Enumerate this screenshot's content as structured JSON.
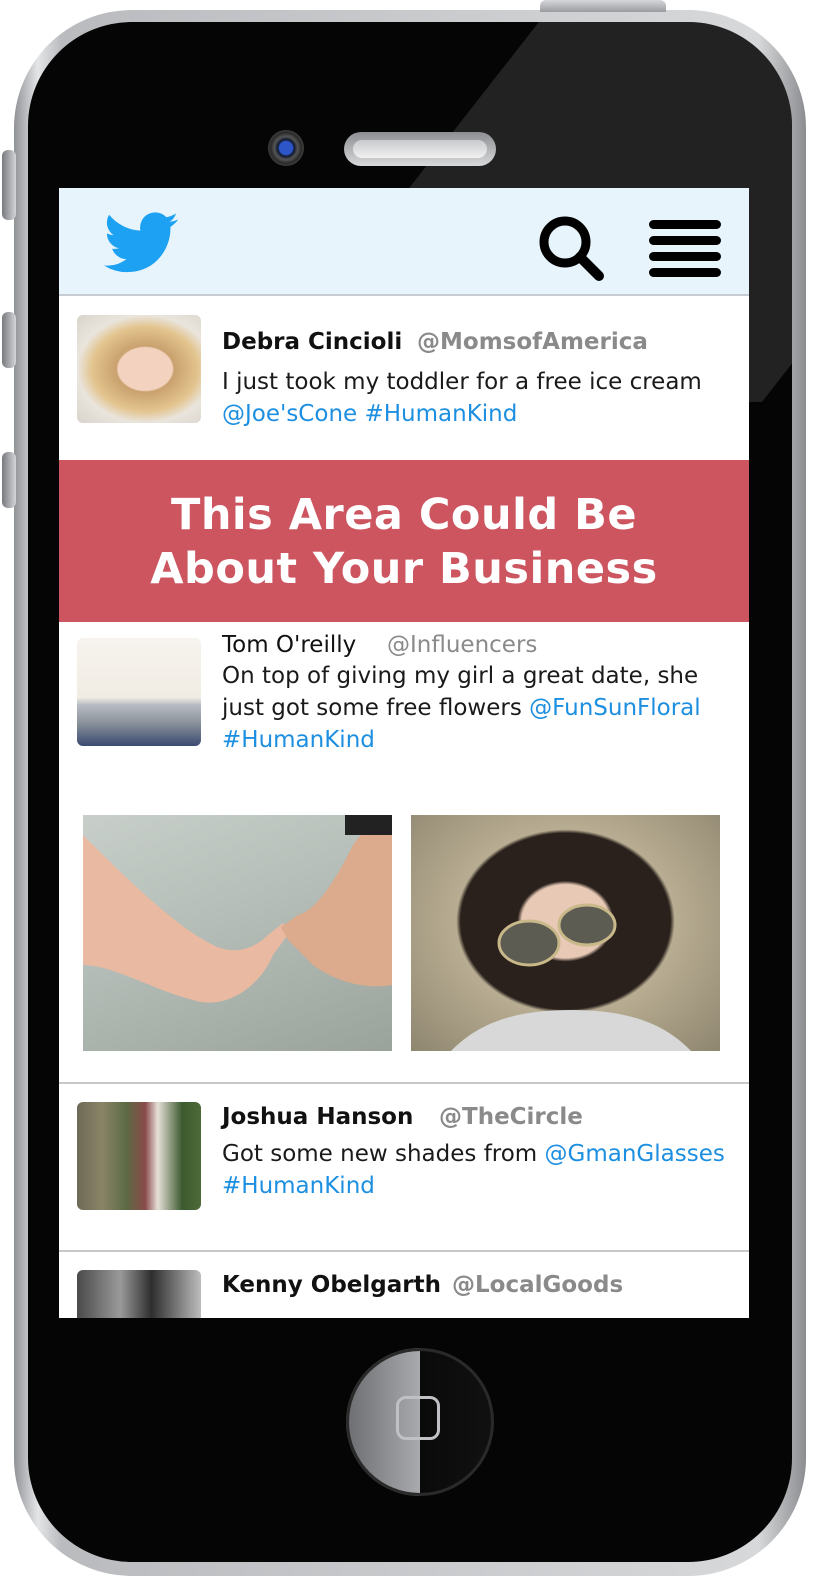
{
  "header": {
    "logo_icon": "twitter-bird-icon",
    "search_icon": "search-icon",
    "menu_icon": "hamburger-menu-icon",
    "logo_color": "#1da1f2"
  },
  "tweets": [
    {
      "name": "Debra Cincioli",
      "handle": "@MomsofAmerica",
      "text": "I just took my toddler for a free ice cream ",
      "mentions": "@Joe'sCone #HumanKind"
    },
    {
      "name": "Tom O'reilly",
      "handle": "@Influencers",
      "text": "On top of giving my girl a great date, she just got some free flowers ",
      "mention": "@FunSunFloral",
      "hashtag": "#HumanKind"
    },
    {
      "name": "Joshua Hanson",
      "handle": "@TheCircle",
      "text": "Got some new shades from ",
      "mentions": "@GmanGlasses #HumanKind"
    },
    {
      "name": "Kenny Obelgarth",
      "handle": "@LocalGoods"
    }
  ],
  "ad": {
    "line1": "This Area Could Be",
    "line2": "About Your Business",
    "color": "#cc5560"
  },
  "colors": {
    "link": "#1d8fe0",
    "handle": "#8a8a8a",
    "header_bg": "#e8f4fc"
  }
}
